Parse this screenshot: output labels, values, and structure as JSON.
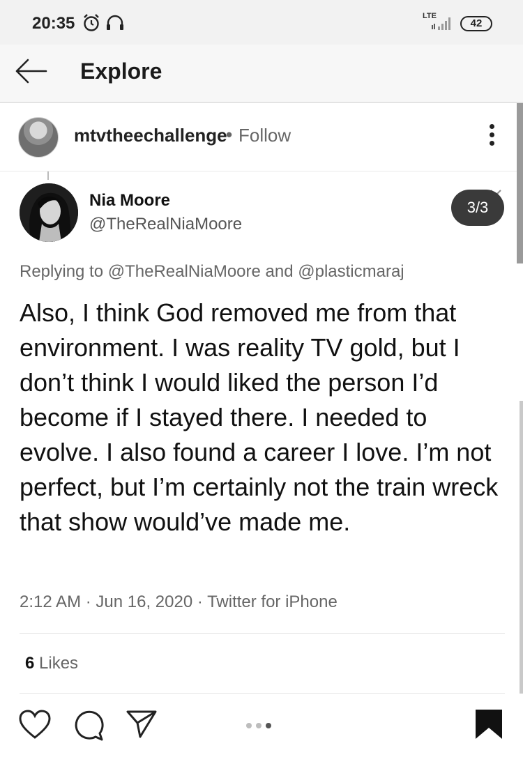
{
  "status_bar": {
    "time": "20:35",
    "network": "LTE",
    "battery": "42"
  },
  "header": {
    "title": "Explore"
  },
  "post": {
    "username": "mtvtheechallenge",
    "separator": "•",
    "follow_label": "Follow"
  },
  "tweet": {
    "name": "Nia Moore",
    "handle": "@TheRealNiaMoore",
    "page_indicator": "3/3",
    "replying_to": "Replying to @TheRealNiaMoore and @plasticmaraj",
    "body": "Also, I think God removed me from that environment. I was reality TV gold, but I don’t think I would liked the person I’d become if I stayed there. I needed to evolve. I also found a career I love. I’m not perfect, but I’m certainly not the train wreck that show would’ve made me.",
    "meta": "2:12 AM · Jun 16, 2020 · Twitter for iPhone"
  },
  "likes": {
    "count": "6",
    "label": "Likes"
  },
  "icons": {
    "alarm": "alarm-icon",
    "headphones": "headphones-icon",
    "back": "arrow-left-icon",
    "more": "more-vertical-icon",
    "like": "heart-icon",
    "comment": "comment-icon",
    "share": "send-icon",
    "save": "bookmark-icon"
  }
}
